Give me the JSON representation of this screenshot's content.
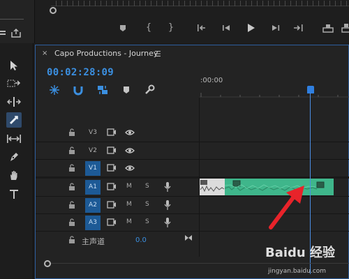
{
  "sequence": {
    "title": "Capo Productions - Journey",
    "timecode": "00:02:28:09",
    "ruler_start": ":00:00"
  },
  "tracks": [
    {
      "name": "V3",
      "type": "video",
      "targeted": false
    },
    {
      "name": "V2",
      "type": "video",
      "targeted": false
    },
    {
      "name": "V1",
      "type": "video",
      "targeted": true
    },
    {
      "name": "A1",
      "type": "audio",
      "targeted": true,
      "mute": "M",
      "solo": "S"
    },
    {
      "name": "A2",
      "type": "audio",
      "targeted": true,
      "mute": "M",
      "solo": "S"
    },
    {
      "name": "A3",
      "type": "audio",
      "targeted": true,
      "mute": "M",
      "solo": "S"
    }
  ],
  "master": {
    "label": "主声道",
    "value": "0.0"
  },
  "tools": [
    "selection-tool",
    "track-select-tool",
    "ripple-edit-tool",
    "razor-tool",
    "slip-tool",
    "pen-tool",
    "hand-tool",
    "type-tool"
  ],
  "watermark": {
    "main": "Baidu 经验",
    "sub": "jingyan.baidu.com"
  },
  "colors": {
    "accent": "#2f7fe0",
    "clip_audio": "#3fb68b",
    "track_target": "#1d5a96",
    "annotation": "#e8232a"
  }
}
